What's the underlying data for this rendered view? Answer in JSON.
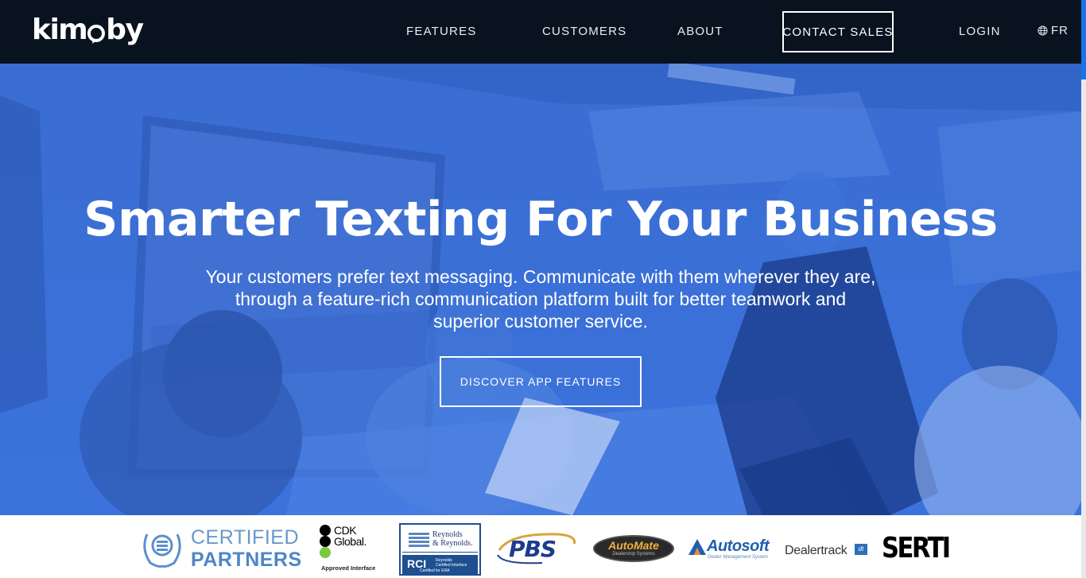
{
  "nav": {
    "logo_text": "kimoby",
    "items": [
      {
        "label": "FEATURES"
      },
      {
        "label": "CUSTOMERS"
      },
      {
        "label": "ABOUT"
      }
    ],
    "contact_label": "CONTACT SALES",
    "login_label": "LOGIN",
    "language_label": "FR",
    "language_icon": "globe-icon"
  },
  "hero": {
    "title": "Smarter Texting For Your Business",
    "subtitle_lines": [
      "Your customers prefer text messaging. Communicate with them wherever they are,",
      "through a feature-rich communication platform built for better teamwork and",
      "superior customer service."
    ],
    "cta_label": "DISCOVER APP FEATURES",
    "overlay_color": "#3a6fd8"
  },
  "partners": {
    "certified": {
      "line1": "CERTIFIED",
      "line2": "PARTNERS"
    },
    "cdk": {
      "line1": "CDK",
      "line2": "Global.",
      "approved": "Approved Interface"
    },
    "reynolds": {
      "line1": "Reynolds",
      "line2": "& Reynolds.",
      "rci": "RCI",
      "small1": "Reynolds",
      "small2": "Certified Interface",
      "certified_for": "Certified for ERA"
    },
    "pbs": "PBS",
    "automate": {
      "name": "AutoMate",
      "sub": "Dealership Systems"
    },
    "autosoft": {
      "name": "Autosoft",
      "sub": "Dealer Management System"
    },
    "dealertrack": {
      "name": "Dealertrack",
      "badge": "dt"
    },
    "serti": "SERTI"
  },
  "colors": {
    "nav_bg": "#08131f",
    "hero_blue": "#3b6fd6",
    "scroll_accent": "#1a73e8"
  }
}
